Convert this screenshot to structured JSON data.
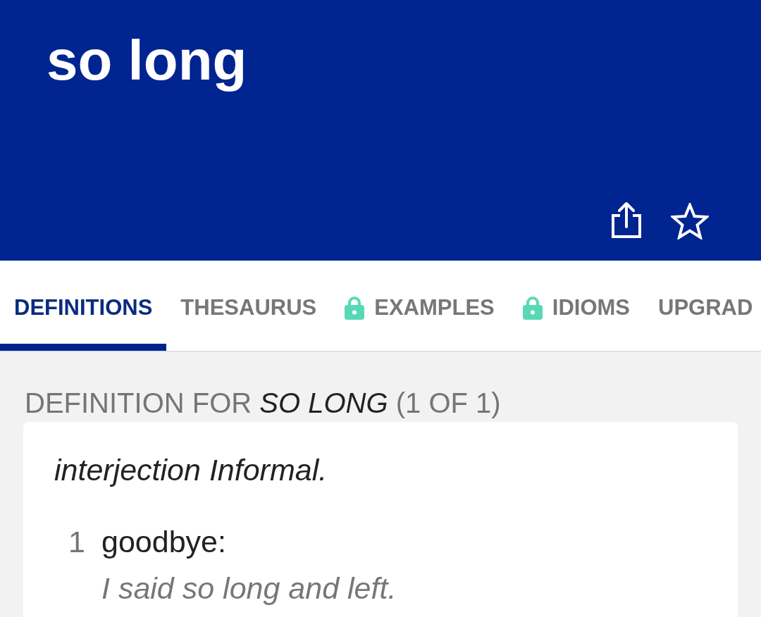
{
  "header": {
    "title": "so long",
    "starred": false
  },
  "tabs": [
    {
      "label": "DEFINITIONS",
      "selected": true,
      "locked": false
    },
    {
      "label": "THESAURUS",
      "selected": false,
      "locked": false
    },
    {
      "label": "EXAMPLES",
      "selected": false,
      "locked": true
    },
    {
      "label": "IDIOMS",
      "selected": false,
      "locked": true
    },
    {
      "label": "UPGRAD",
      "selected": false,
      "locked": false
    }
  ],
  "definition": {
    "heading": "DEFINITION FOR *SO LONG* (1 OF 1)",
    "part_of_speech": "interjection Informal.",
    "senses": [
      {
        "number": "1",
        "text": "goodbye:",
        "example": "I said so long and left."
      }
    ]
  }
}
